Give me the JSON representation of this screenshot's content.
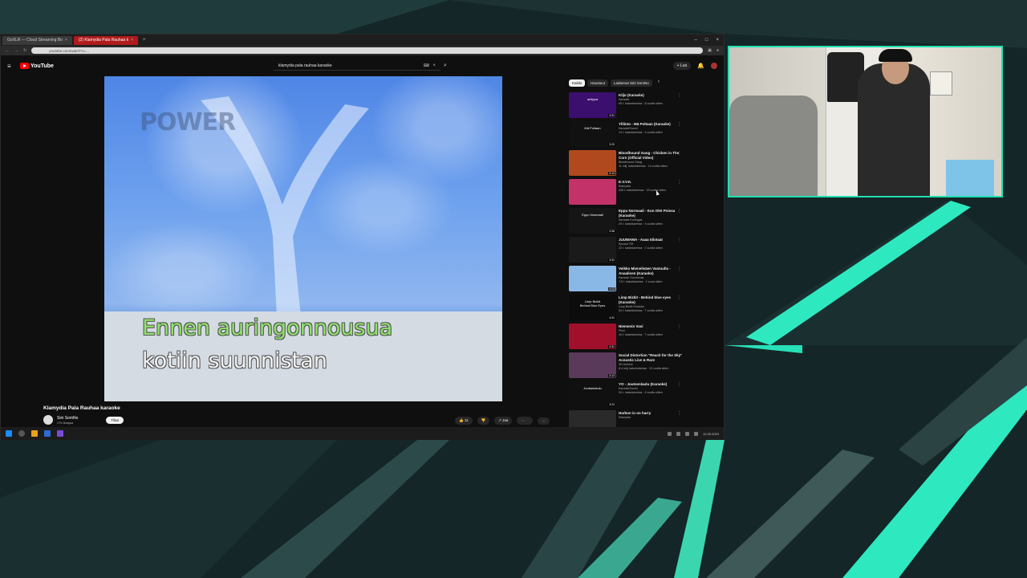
{
  "browser": {
    "tabs": [
      {
        "label": "GoXLR — Cloud Streaming Bo"
      },
      {
        "label": "(2) Klamydia Pala Rauhaa k"
      }
    ],
    "address": "youtube.com/watch?v=...",
    "new_tab": "+"
  },
  "youtube": {
    "logo_text": "YouTube",
    "search_value": "klamydia pala rauhaa karaoke",
    "create_label": "Luo",
    "video": {
      "logo_text": "POWER",
      "lyric_line1_highlight": "Ennen auringonnousua",
      "lyric_line2": "kotiin suunnistan",
      "title": "Klamydia Pala Rauhaa karaoke",
      "channel": "Sini SomNo",
      "subs": "27k tilaajaa",
      "subscribe": "Tilaa",
      "likes": "11",
      "share": "Jaa"
    },
    "chips": [
      "Kaikki",
      "Haustuut",
      "Ladannut Sini SomNo"
    ],
    "recs": [
      {
        "title": "Kiljo (Karaoke)",
        "channel": "Karaoke",
        "stats": "65 t. katselukertaa · 8 vuotta sitten",
        "duration": "4:31",
        "thumb_color": "#3b0f6e",
        "thumb_text": "antigua"
      },
      {
        "title": "Ylilinto - Mä Poltaan (Karaoke)",
        "channel": "KaraokeSuomi",
        "stats": "14 t. katselukertaa · 4 vuotta sitten",
        "duration": "3:20",
        "thumb_color": "#111111",
        "thumb_text": "Mä Poltaan"
      },
      {
        "title": "Bloodhound Gang - Chicken in The Corn (Official Video)",
        "channel": "Bloodhound Gang",
        "stats": "11 milj. katselukertaa · 14 vuotta sitten",
        "duration": "3:14",
        "thumb_color": "#b04a1e",
        "thumb_text": ""
      },
      {
        "title": "E.V.V.K.",
        "channel": "Klamydia",
        "stats": "428 t. katselukertaa · 15 vuotta sitten",
        "duration": "",
        "thumb_color": "#c4326a",
        "thumb_text": ""
      },
      {
        "title": "Eppu Normaali - Kun Olet Poissa (Karaoke)",
        "channel": "Karaoke Kuningas",
        "stats": "29 t. katselukertaa · 4 vuotta sitten",
        "duration": "3:36",
        "thumb_color": "#151515",
        "thumb_text": "Eppu Normaali"
      },
      {
        "title": "JUUWAMA - Aaaa Idiotaat",
        "channel": "Eposiut TM",
        "stats": "22 t. katselukertaa · 2 vuotta sitten",
        "duration": "3:31",
        "thumb_color": "#1a1a1a",
        "thumb_text": ""
      },
      {
        "title": "Veikko Mieneilsäen Vastuulla - Anaalinen (Karaoke)",
        "channel": "Karaoke Suomessa",
        "stats": "7,8 t. katselukertaa · 1 vuosi sitten",
        "duration": "4:23",
        "thumb_color": "#8ab8e6",
        "thumb_text": ""
      },
      {
        "title": "Limp Bizkit - Behind blue eyes (Karaoke)",
        "channel": "Limp Bizkit Karaoke",
        "stats": "54 t. katselukertaa · 7 vuotta sitten",
        "duration": "4:31",
        "thumb_color": "#0c0c0c",
        "thumb_text": "Limp Bizkit\nBehind Blue Eyes"
      },
      {
        "title": "Niemenin Vasi",
        "channel": "Pinni",
        "stats": "44 t. katselukertaa · 7 vuotta sitten",
        "duration": "4:31",
        "thumb_color": "#a0102a",
        "thumb_text": ""
      },
      {
        "title": "Social Distortion \"Reach for the Sky\" Acoustic Live & Rare",
        "channel": "SD Archive",
        "stats": "8,4 milj. katselukertaa · 13 vuotta sitten",
        "duration": "3:12",
        "thumb_color": "#5a3a5a",
        "thumb_text": ""
      },
      {
        "title": "YO - Joutsenlaulu (Karaoke)",
        "channel": "KaraokeSuomi",
        "stats": "53 t. katselukertaa · 4 vuotta sitten",
        "duration": "3:24",
        "thumb_color": "#101010",
        "thumb_text": "Joutsenlaulu"
      },
      {
        "title": "Harbon in on harry",
        "channel": "Klamydia",
        "stats": "",
        "duration": "",
        "thumb_color": "#2a2a2a",
        "thumb_text": ""
      }
    ]
  },
  "taskbar": {
    "clock": "12.05.2023"
  },
  "colors": {
    "accent": "#1fe0b0",
    "yt_red": "#ff0000",
    "lyric_highlight": "#8fe36a"
  }
}
